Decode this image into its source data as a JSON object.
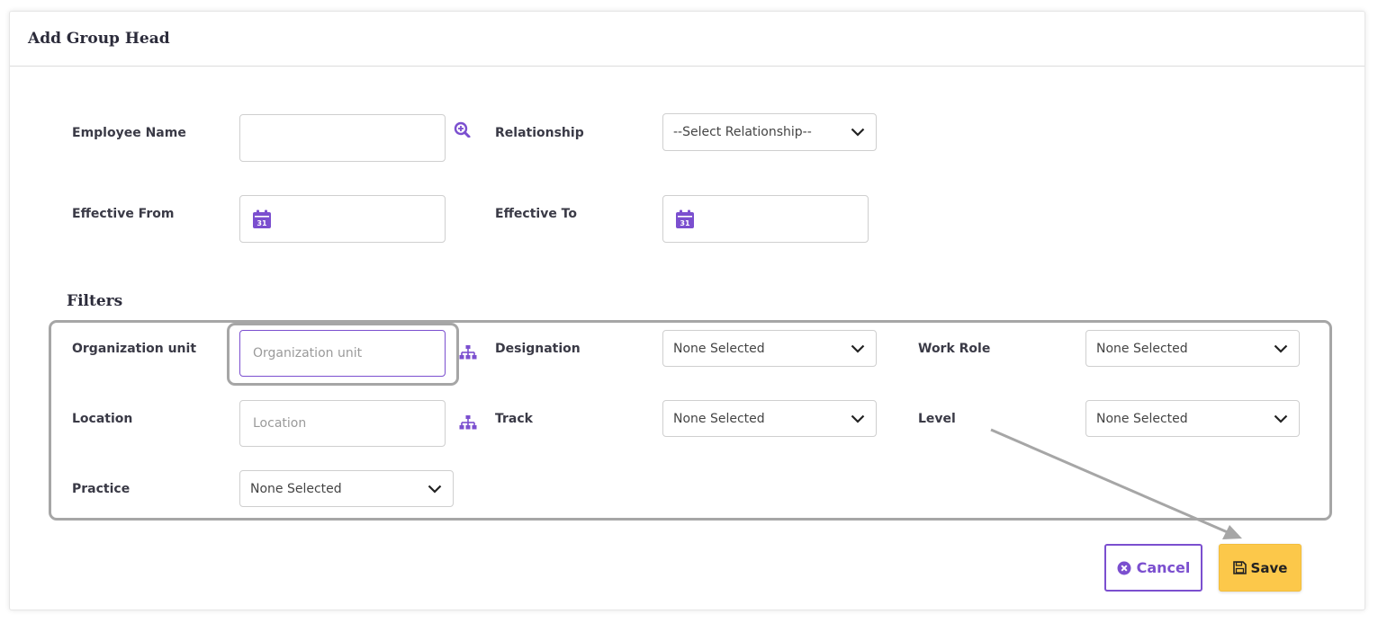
{
  "header": {
    "title": "Add Group Head"
  },
  "form": {
    "employee_name": {
      "label": "Employee Name",
      "value": ""
    },
    "relationship": {
      "label": "Relationship",
      "selected": "--Select Relationship--"
    },
    "effective_from": {
      "label": "Effective From",
      "value": ""
    },
    "effective_to": {
      "label": "Effective To",
      "value": ""
    }
  },
  "filters": {
    "title": "Filters",
    "organization_unit": {
      "label": "Organization unit",
      "placeholder": "Organization unit"
    },
    "designation": {
      "label": "Designation",
      "selected": "None Selected"
    },
    "work_role": {
      "label": "Work Role",
      "selected": "None Selected"
    },
    "location": {
      "label": "Location",
      "placeholder": "Location"
    },
    "track": {
      "label": "Track",
      "selected": "None Selected"
    },
    "level": {
      "label": "Level",
      "selected": "None Selected"
    },
    "practice": {
      "label": "Practice",
      "selected": "None Selected"
    }
  },
  "actions": {
    "cancel_label": "Cancel",
    "save_label": "Save"
  },
  "icons": {
    "search": "search-plus-icon",
    "calendar": "calendar-icon",
    "org_tree": "sitemap-icon",
    "chevron": "chevron-down-icon",
    "cancel": "times-circle-icon",
    "save": "floppy-disk-icon"
  },
  "colors": {
    "accent": "#7b4fcf",
    "save_button": "#fcc84a",
    "annotation": "#a6a6a6"
  }
}
